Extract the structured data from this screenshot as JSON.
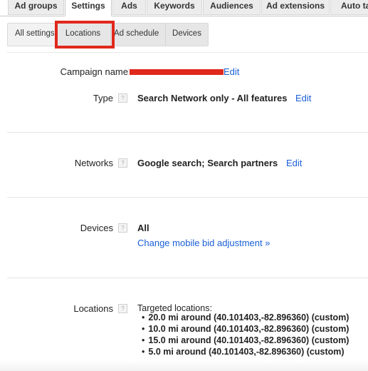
{
  "tabs": [
    {
      "label": "Ad groups",
      "active": false
    },
    {
      "label": "Settings",
      "active": true
    },
    {
      "label": "Ads",
      "active": false
    },
    {
      "label": "Keywords",
      "active": false
    },
    {
      "label": "Audiences",
      "active": false
    },
    {
      "label": "Ad extensions",
      "active": false
    },
    {
      "label": "Auto ta",
      "active": false
    }
  ],
  "subtabs": [
    {
      "label": "All settings",
      "selected": true
    },
    {
      "label": "Locations",
      "selected": false,
      "highlighted": true
    },
    {
      "label": "Ad schedule",
      "selected": false
    },
    {
      "label": "Devices",
      "selected": false
    }
  ],
  "highlight_color": "#e0281c",
  "link_color": "#1a5fd6",
  "settings": {
    "campaign_name": {
      "label": "Campaign name",
      "value": "[redacted]",
      "edit": "Edit"
    },
    "type": {
      "label": "Type",
      "help": "?",
      "value": "Search Network only - All features",
      "edit": "Edit"
    },
    "networks": {
      "label": "Networks",
      "help": "?",
      "value": "Google search; Search partners",
      "edit": "Edit"
    },
    "devices": {
      "label": "Devices",
      "help": "?",
      "value": "All",
      "link": "Change mobile bid adjustment »"
    },
    "locations": {
      "label": "Locations",
      "help": "?",
      "heading": "Targeted locations:",
      "items": [
        "20.0 mi around (40.101403,-82.896360) (custom)",
        "10.0 mi around (40.101403,-82.896360) (custom)",
        "15.0 mi around (40.101403,-82.896360) (custom)",
        "5.0 mi around (40.101403,-82.896360) (custom)"
      ]
    }
  }
}
